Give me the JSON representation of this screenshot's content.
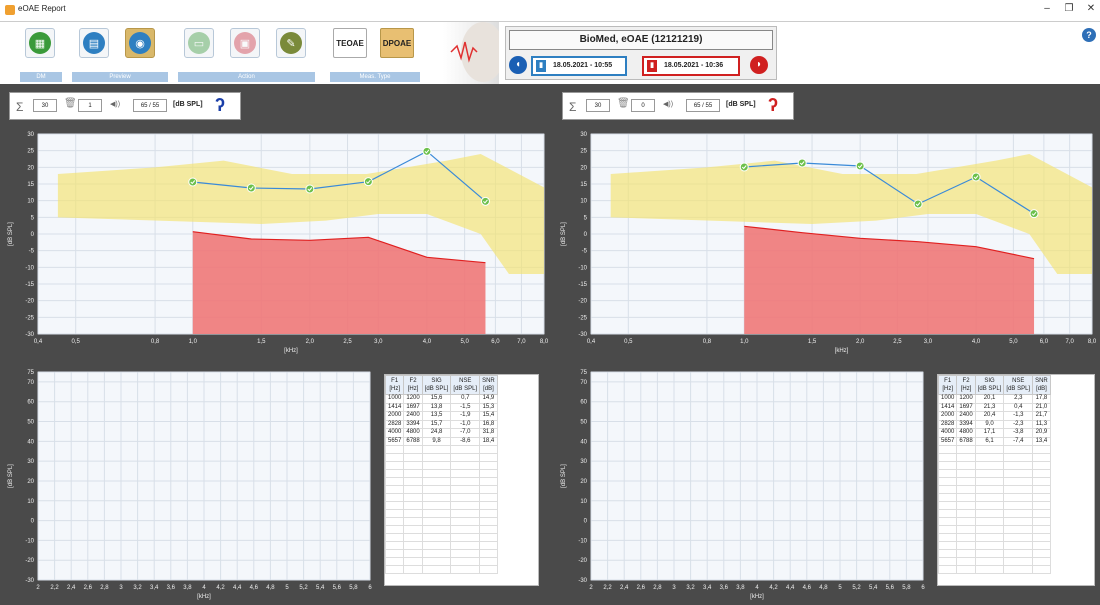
{
  "window": {
    "title": "eOAE Report"
  },
  "ribbon": {
    "groups": [
      "DM",
      "Preview",
      "Action",
      "Meas. Type"
    ],
    "meas_types": [
      "TEOAE",
      "DPOAE"
    ]
  },
  "patient": {
    "name": "BioMed, eOAE (12121219)",
    "right_date": "18.05.2021 - 10:55",
    "left_date": "18.05.2021 - 10:36"
  },
  "panels": [
    {
      "side": "right",
      "sum": "30",
      "count": "1",
      "level": "65 / 55",
      "unit": "[dB SPL]",
      "ear_color": "#1a3ea8",
      "table": {
        "headers": [
          [
            "F1",
            "[Hz]"
          ],
          [
            "F2",
            "[Hz]"
          ],
          [
            "SIG",
            "[dB SPL]"
          ],
          [
            "NSE",
            "[dB SPL]"
          ],
          [
            "SNR",
            "[dB]"
          ]
        ],
        "rows": [
          [
            "1000",
            "1200",
            "15,6",
            "0,7",
            "14,9"
          ],
          [
            "1414",
            "1697",
            "13,8",
            "-1,5",
            "15,3"
          ],
          [
            "2000",
            "2400",
            "13,5",
            "-1,9",
            "15,4"
          ],
          [
            "2828",
            "3394",
            "15,7",
            "-1,0",
            "16,8"
          ],
          [
            "4000",
            "4800",
            "24,8",
            "-7,0",
            "31,8"
          ],
          [
            "5657",
            "6788",
            "9,8",
            "-8,6",
            "18,4"
          ]
        ]
      }
    },
    {
      "side": "left",
      "sum": "30",
      "count": "0",
      "level": "65 / 55",
      "unit": "[dB SPL]",
      "ear_color": "#d02020",
      "table": {
        "headers": [
          [
            "F1",
            "[Hz]"
          ],
          [
            "F2",
            "[Hz]"
          ],
          [
            "SIG",
            "[dB SPL]"
          ],
          [
            "NSE",
            "[dB SPL]"
          ],
          [
            "SNR",
            "[dB]"
          ]
        ],
        "rows": [
          [
            "1000",
            "1200",
            "20,1",
            "2,3",
            "17,8"
          ],
          [
            "1414",
            "1697",
            "21,3",
            "0,4",
            "21,0"
          ],
          [
            "2000",
            "2400",
            "20,4",
            "-1,3",
            "21,7"
          ],
          [
            "2828",
            "3394",
            "9,0",
            "-2,3",
            "11,3"
          ],
          [
            "4000",
            "4800",
            "17,1",
            "-3,8",
            "20,9"
          ],
          [
            "5657",
            "6788",
            "6,1",
            "-7,4",
            "13,4"
          ]
        ]
      }
    }
  ],
  "chart_data": [
    {
      "type": "line",
      "ylabel": "[dB SPL]",
      "xlabel": "[kHz]",
      "ylim": [
        -30,
        30
      ],
      "x_ticks": [
        "0,4",
        "0,5",
        "0,8",
        "1,0",
        "1,5",
        "2,0",
        "2,5",
        "3,0",
        "4,0",
        "5,0",
        "6,0",
        "7,0",
        "8,0"
      ],
      "y_ticks": [
        "30",
        "25",
        "20",
        "15",
        "10",
        "5",
        "0",
        "-5",
        "-10",
        "-15",
        "-20",
        "-25",
        "-30"
      ],
      "series": [
        {
          "name": "SIG",
          "x": [
            1.0,
            1.414,
            2.0,
            2.828,
            4.0,
            5.657
          ],
          "y": [
            15.6,
            13.8,
            13.5,
            15.7,
            24.8,
            9.8
          ]
        },
        {
          "name": "NSE",
          "x": [
            1.0,
            1.414,
            2.0,
            2.828,
            4.0,
            5.657
          ],
          "y": [
            0.7,
            -1.5,
            -1.9,
            -1.0,
            -7.0,
            -8.6
          ]
        }
      ]
    },
    {
      "type": "line",
      "ylabel": "[dB SPL]",
      "xlabel": "[kHz]",
      "ylim": [
        -30,
        30
      ],
      "x_ticks": [
        "0,4",
        "0,5",
        "0,8",
        "1,0",
        "1,5",
        "2,0",
        "2,5",
        "3,0",
        "4,0",
        "5,0",
        "6,0",
        "7,0",
        "8,0"
      ],
      "y_ticks": [
        "30",
        "25",
        "20",
        "15",
        "10",
        "5",
        "0",
        "-5",
        "-10",
        "-15",
        "-20",
        "-25",
        "-30"
      ],
      "series": [
        {
          "name": "SIG",
          "x": [
            1.0,
            1.414,
            2.0,
            2.828,
            4.0,
            5.657
          ],
          "y": [
            20.1,
            21.3,
            20.4,
            9.0,
            17.1,
            6.1
          ]
        },
        {
          "name": "NSE",
          "x": [
            1.0,
            1.414,
            2.0,
            2.828,
            4.0,
            5.657
          ],
          "y": [
            2.3,
            0.4,
            -1.3,
            -2.3,
            -3.8,
            -7.4
          ]
        }
      ]
    },
    {
      "type": "line",
      "ylabel": "[dB SPL]",
      "xlabel": "[kHz]",
      "ylim": [
        -30,
        75
      ],
      "x_ticks": [
        "2",
        "2,2",
        "2,4",
        "2,6",
        "2,8",
        "3",
        "3,2",
        "3,4",
        "3,6",
        "3,8",
        "4",
        "4,2",
        "4,4",
        "4,6",
        "4,8",
        "5",
        "5,2",
        "5,4",
        "5,6",
        "5,8",
        "6"
      ],
      "y_ticks": [
        "75",
        "70",
        "60",
        "50",
        "40",
        "30",
        "20",
        "10",
        "0",
        "-10",
        "-20",
        "-30"
      ],
      "series": []
    },
    {
      "type": "line",
      "ylabel": "[dB SPL]",
      "xlabel": "[kHz]",
      "ylim": [
        -30,
        75
      ],
      "x_ticks": [
        "2",
        "2,2",
        "2,4",
        "2,6",
        "2,8",
        "3",
        "3,2",
        "3,4",
        "3,6",
        "3,8",
        "4",
        "4,2",
        "4,4",
        "4,6",
        "4,8",
        "5",
        "5,2",
        "5,4",
        "5,6",
        "5,8",
        "6"
      ],
      "y_ticks": [
        "75",
        "70",
        "60",
        "50",
        "40",
        "30",
        "20",
        "10",
        "0",
        "-10",
        "-20",
        "-30"
      ],
      "series": []
    }
  ]
}
